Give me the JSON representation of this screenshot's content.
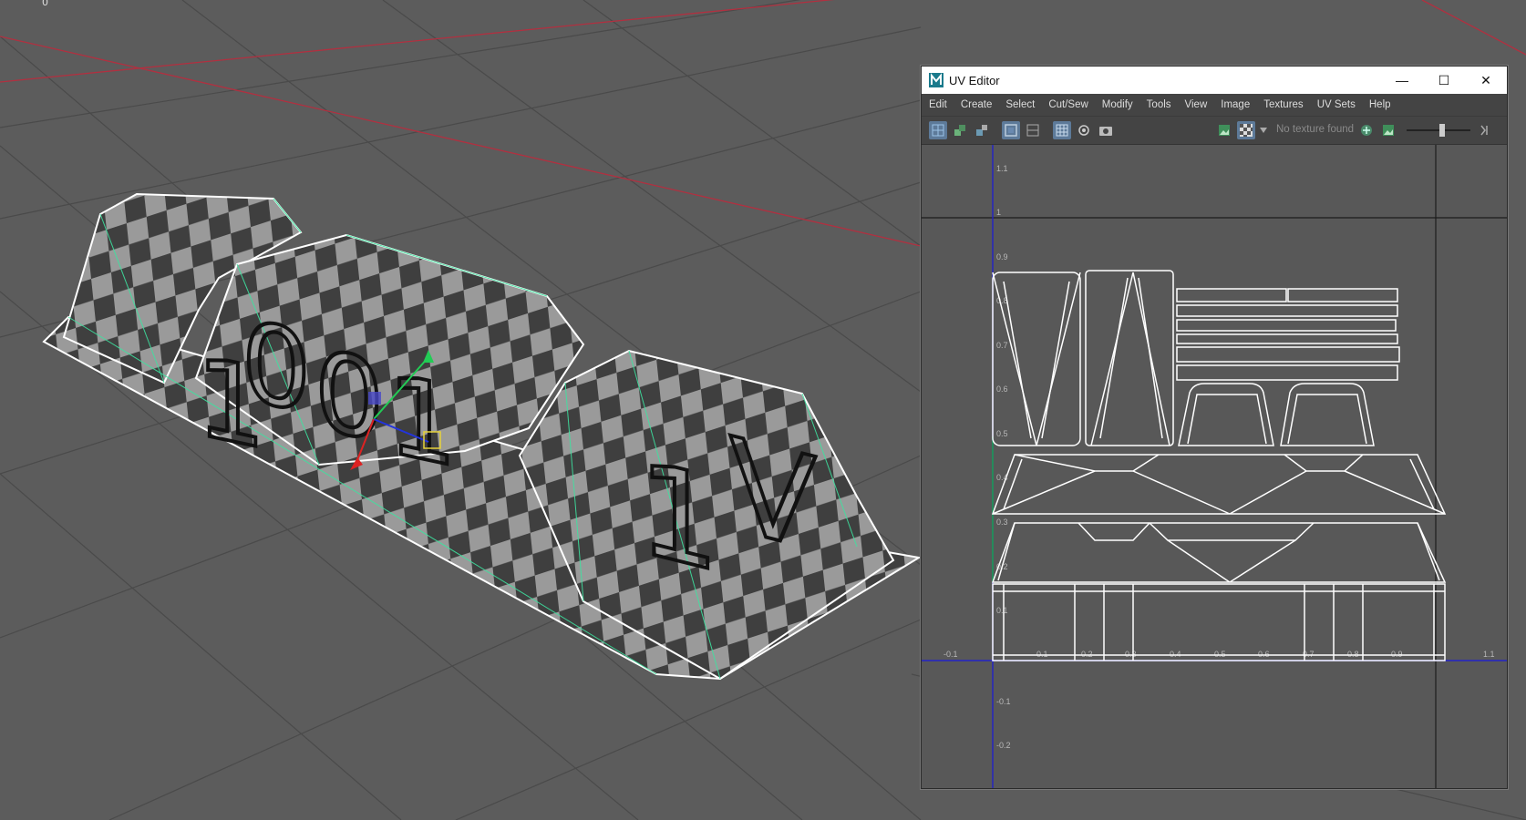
{
  "viewport": {
    "corner_label": "0",
    "uv_numbers": [
      "1",
      "0",
      "0",
      "1",
      "1",
      "V"
    ]
  },
  "uv_editor": {
    "title": "UV Editor",
    "window_buttons": {
      "minimize": "—",
      "maximize": "☐",
      "close": "✕"
    },
    "menus": [
      "Edit",
      "Create",
      "Select",
      "Cut/Sew",
      "Modify",
      "Tools",
      "View",
      "Image",
      "Textures",
      "UV Sets",
      "Help"
    ],
    "texture_status": "No texture found",
    "axis": {
      "v_ticks": [
        "1.1",
        "1",
        "0.9",
        "0.8",
        "0.7",
        "0.6",
        "0.5",
        "0.4",
        "0.3",
        "0.2",
        "0.1",
        "-0.1",
        "-0.2"
      ],
      "u_ticks": [
        "-0.1",
        "0.1",
        "0.2",
        "0.3",
        "0.4",
        "0.5",
        "0.6",
        "0.7",
        "0.8",
        "0.9",
        "1.1"
      ]
    },
    "colors": {
      "accent": "#5d7a99",
      "u_axis": "#2323c8",
      "v_axis": "#2323c8",
      "wire": "#ffffff"
    }
  }
}
